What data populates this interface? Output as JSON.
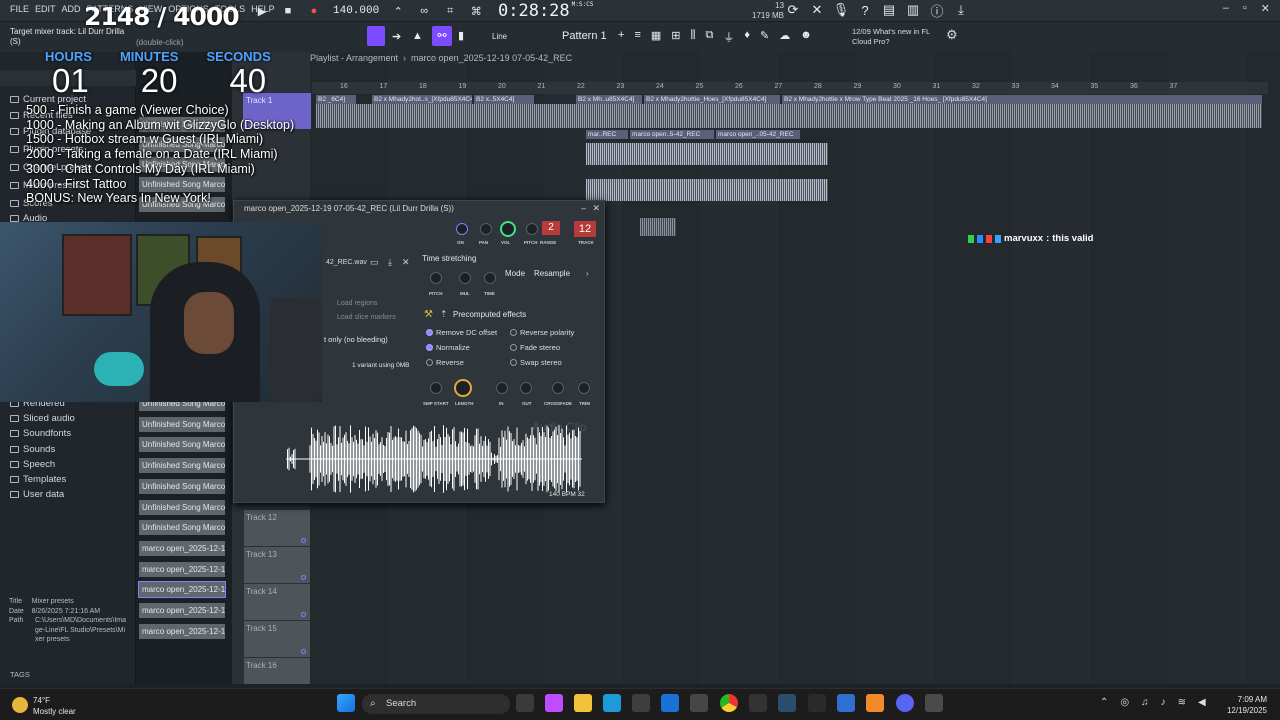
{
  "menu": [
    "FILE",
    "EDIT",
    "ADD",
    "PATTERNS",
    "VIEW",
    "OPTIONS",
    "TOOLS",
    "HELP"
  ],
  "hint": {
    "line1": "Target mixer track: Lil Durr Drilla",
    "line2": "(S)",
    "line3": "(double-click)"
  },
  "transport": {
    "tempo": "140.000",
    "time": "0:28:28",
    "time_sub": "M:S:CS",
    "cpu_line1": "13",
    "cpu_mem": "1719 MB",
    "cpu_line3": "0"
  },
  "toolbar2": {
    "line_label": "Line",
    "pattern_label": "Pattern 1"
  },
  "whats_new": {
    "date": "12/09",
    "text1": "What's new in FL",
    "text2": "Cloud Pro?"
  },
  "overlay": {
    "counter": "2148 / 4000",
    "timer_labels": [
      "HOURS",
      "MINUTES",
      "SECONDS"
    ],
    "timer_values": [
      "01",
      "20",
      "40"
    ],
    "goals": [
      "500 - Finish a game (Viewer Choice)",
      "1000 - Making an Album wit GlizzyGlo (Desktop)",
      "1500 - Hotbox stream w Guest (IRL Miami)",
      "2000 - Taking a female on a Date (IRL Miami)",
      "3000 - Chat Controls My Day (IRL Miami)",
      "4000 - First Tattoo",
      "BONUS: New Years In New York!"
    ]
  },
  "browser": {
    "items_top": [
      "Current project",
      "Recent files",
      "Plugin database",
      "Plugin presets",
      "Channel presets",
      "Mixer presets",
      "Scores",
      "Audio"
    ],
    "items_bottom": [
      "Rendered",
      "Sliced audio",
      "Soundfonts",
      "Sounds",
      "Speech",
      "Templates",
      "User data"
    ],
    "meta_title_label": "Title",
    "meta_title": "Mixer presets",
    "meta_date_label": "Date",
    "meta_date": "8/26/2025 7:21:16 AM",
    "meta_path_label": "Path",
    "meta_path": "C:\\Users\\MD\\Documents\\Image-Line\\FL Studio\\Presets\\Mixer presets",
    "tags_label": "TAGS"
  },
  "channels": [
    "Unfinished Song Marco_2...",
    "Unfinished Song Marco_2...",
    "Unfinished Song Marco_2...",
    "Unfinished Song Marco_2...",
    "Unfinished Song Marco_2...",
    "Unfinished Song Marco_2...",
    "Unfinished Song Marco_2...",
    "Unfinished Song Marco_2...",
    "Unfinished Song Marco_2...",
    "Unfinished Song Marco_2...",
    "Unfinished Song Marco_2...",
    "Unfinished Song Marco_2...",
    "marco open_2025-12-19...",
    "marco open_2025-12-19...",
    "marco open_2025-12-19...",
    "marco open_2025-12-19...",
    "marco open_2025-12-19..."
  ],
  "playlist": {
    "title": "Playlist - Arrangement",
    "arrangement": "marco open_2025-12-19 07-05-42_REC",
    "ruler": [
      "16",
      "17",
      "18",
      "19",
      "20",
      "21",
      "22",
      "23",
      "24",
      "25",
      "26",
      "27",
      "28",
      "29",
      "30",
      "31",
      "32",
      "33",
      "34",
      "35",
      "36",
      "37"
    ],
    "track_first": "Track 1",
    "tracks": [
      "Track 12",
      "Track 13",
      "Track 14",
      "Track 15",
      "Track 16"
    ],
    "clips": [
      "B2 _6C4]",
      "B2 x Mhady2hot..s_[Xfpdu85X4C4]",
      "B2 x..5X4C4]",
      "B2 x Mh..u85X4C4]",
      "B2 x Mhady2hottie_Hoes_[Xfpdu85X4C4]",
      "B2 x Mhady2hottie x Mrow Type Beat 2025 _16 Hoes_ [Xfpdu85X4C4]"
    ],
    "rec_clips": [
      "mar..REC",
      "marco open..5-42_REC",
      "marco open_..05-42_REC"
    ]
  },
  "chat": {
    "user": "marvuxx",
    "message": "this valid"
  },
  "channel_window": {
    "title": "marco open_2025-12-19 07-05-42_REC (Lil Durr Drilla (S))",
    "file_label": "42_REC.wav",
    "knob_labels": [
      "ON",
      "PAN",
      "VOL",
      "PITCH",
      "RANGE",
      "TRACK"
    ],
    "range_value": "2",
    "track_value": "12",
    "time_stretching": "Time stretching",
    "mode_label": "Mode",
    "mode_value": "Resample",
    "ts_knobs": [
      "PITCH",
      "MUL",
      "TIME"
    ],
    "load_regions": "Load regions",
    "load_slice": "Load slice markers",
    "bleeding": "t only (no bleeding)",
    "variant": "1 variant using 0MB",
    "precomputed": "Precomputed effects",
    "effects": [
      "Remove DC offset",
      "Reverse polarity",
      "Normalize",
      "Fade stereo",
      "Reverse",
      "Swap stereo"
    ],
    "bottom_knobs": [
      "SMP START",
      "LENGTH",
      "IN",
      "OUT",
      "CROSSFADE",
      "TRIM"
    ],
    "watermark": "Audio Clip",
    "bpm": "140 BPM 32"
  },
  "taskbar": {
    "temp": "74°F",
    "weather": "Mostly clear",
    "search": "Search",
    "time": "7:09 AM",
    "date": "12/19/2025"
  },
  "colors": {
    "accent": "#8b7bff",
    "overlay_blue": "#4da3ff",
    "clip": "#5a5f7a"
  }
}
